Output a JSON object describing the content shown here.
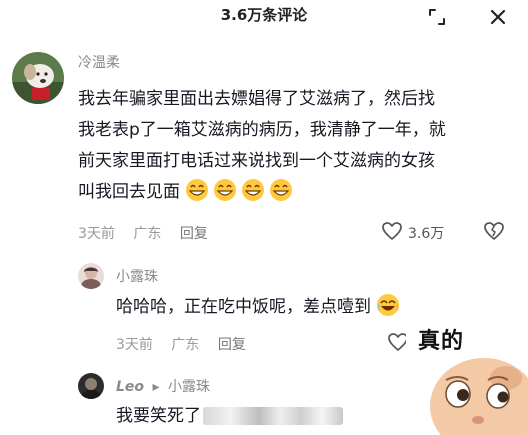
{
  "header": {
    "title": "3.6万条评论"
  },
  "comment1": {
    "author": "冷温柔",
    "lines": [
      "我去年骗家里面出去嫖娼得了艾滋病了，然后找",
      "我老表p了一箱艾滋病的病历，我清静了一年，就",
      "前天家里面打电话过来说找到一个艾滋病的女孩",
      "叫我回去见面"
    ],
    "emojis": [
      "grin-emoji",
      "grin-emoji",
      "grin-emoji",
      "grin-emoji"
    ],
    "time": "3天前",
    "location": "广东",
    "reply_label": "回复",
    "like_count": "3.6万"
  },
  "reply1": {
    "author": "小露珠",
    "text": "哈哈哈，正在吃中饭呢，差点噎到",
    "emoji": "laugh-cry-emoji",
    "time": "3天前",
    "location": "广东",
    "reply_label": "回复"
  },
  "reply2": {
    "author": "Leo",
    "reply_to": "小露珠",
    "text": "我要笑死了"
  },
  "sticker": {
    "text": "真的"
  },
  "colors": {
    "muted": "#9a9a9a",
    "text": "#161823",
    "background": "#ffffff"
  }
}
